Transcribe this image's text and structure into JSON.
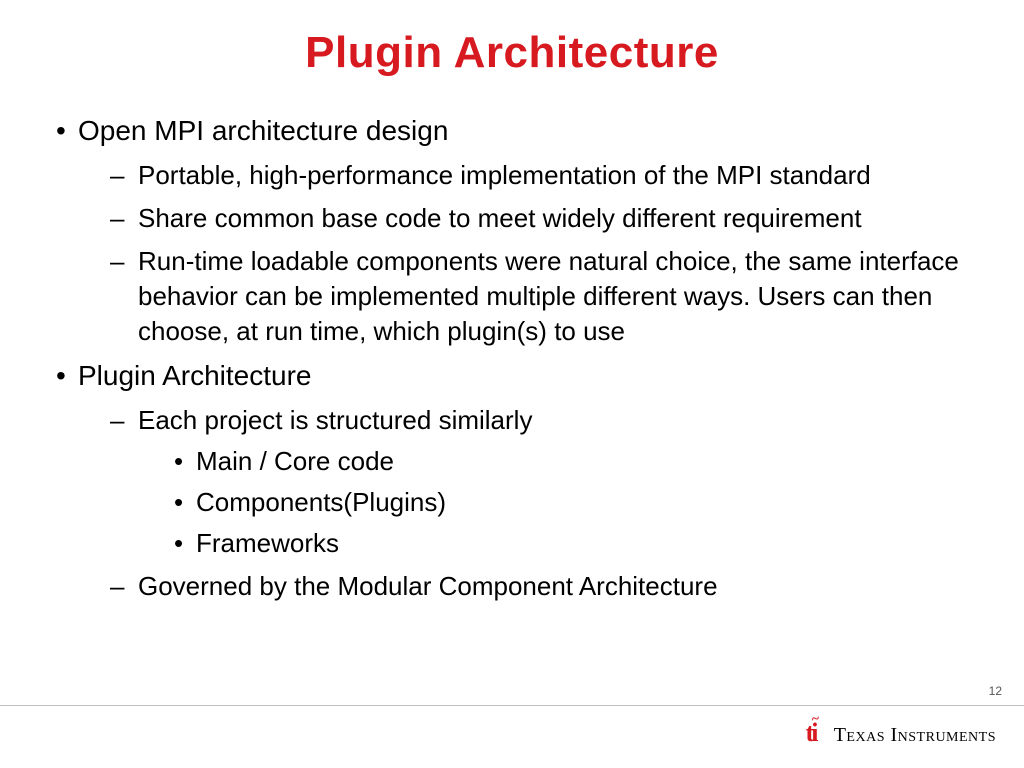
{
  "title": "Plugin Architecture",
  "b1": {
    "label": "Open MPI architecture design",
    "s1": " Portable, high-performance implementation of the MPI standard",
    "s2": "Share common base code to meet widely different requirement",
    "s3": "Run-time loadable components were natural choice, the same interface behavior can be implemented multiple different ways. Users can then choose, at run time, which plugin(s) to use"
  },
  "b2": {
    "label": "Plugin Architecture",
    "s1": "Each project is structured similarly",
    "s1_items": {
      "i1": "Main / Core code",
      "i2": "Components(Plugins)",
      "i3": "Frameworks"
    },
    "s2": "Governed by the Modular Component Architecture"
  },
  "page_number": "12",
  "brand": "Texas Instruments"
}
